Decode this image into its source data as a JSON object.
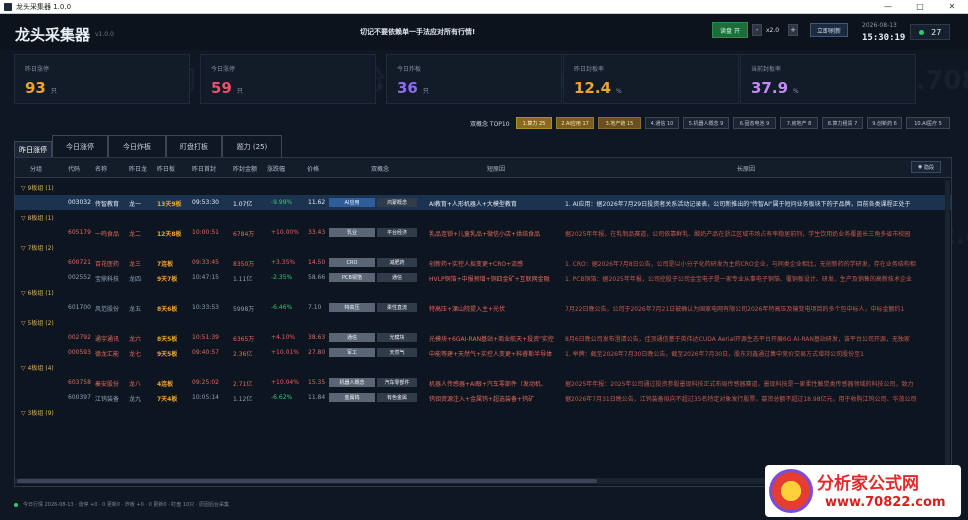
{
  "window": {
    "title": "龙头采集器 1.0.0",
    "min": "—",
    "max": "□",
    "close": "✕"
  },
  "header": {
    "app_title": "龙头采集器",
    "version": "v1.0.0",
    "slogan": "切记不要依赖单一手法应对所有行情!",
    "auto_btn": "读盘 开",
    "minus": "-",
    "speed": "x2.0",
    "plus": "+",
    "refresh_btn": "立即刷新",
    "date": "2026-08-13",
    "time": "15:30:19",
    "count": "27",
    "status_color": "#2ecc71"
  },
  "stats": [
    {
      "label": "昨日涨停",
      "value": "93",
      "unit": "只",
      "color": "#f0a32a"
    },
    {
      "label": "今日涨停",
      "value": "59",
      "unit": "只",
      "color": "#ef4f6a"
    },
    {
      "label": "今日炸板",
      "value": "36",
      "unit": "只",
      "color": "#8d6cf0"
    },
    {
      "label": "昨日封板率",
      "value": "12.4",
      "unit": "%",
      "color": "#f0a32a"
    },
    {
      "label": "当前封板率",
      "value": "37.9",
      "unit": "%",
      "color": "#c58af5"
    }
  ],
  "concepts": {
    "label": "双概念 TOP10",
    "items": [
      "1.算力 25",
      "2.AI应用 17",
      "3.地产链 15",
      "4.通信 10",
      "5.机器人概念 9",
      "6.固态电池 9",
      "7.房地产 8",
      "8.算力租赁 7",
      "9.创新药 6",
      "10.AI医疗 5"
    ]
  },
  "tabs": [
    "昨日涨停",
    "今日涨停",
    "今日炸板",
    "盯盘打板",
    "题力 (25)"
  ],
  "table": {
    "headers": [
      "分组",
      "代码",
      "名称",
      "昨日龙",
      "昨日板",
      "昨日首封",
      "昨封金额",
      "涨跌幅",
      "价格",
      "双概念",
      "短原因",
      "长原因"
    ],
    "hide_btn": "隐段",
    "groups": [
      {
        "label": "▽ 9板组 (1)",
        "rows": [
          {
            "code": "003032",
            "name": "传智教育",
            "dragon": "龙一",
            "board": "13天9板",
            "first": "09:53:30",
            "amount": "1.07亿",
            "chg": "-9.99%",
            "price": "11.62",
            "tag1": "AI应用",
            "tag2": "鸿蒙概念",
            "short": "AI教育+人形机器人+大模型教育",
            "long": "1. AI应用：据2026年7月29日投资者关系活动记录表，公司新推出的\"传智AI\"属于短问业务板块下的子品牌，目前各类课程正处于",
            "sel": true
          }
        ]
      },
      {
        "label": "▽ 8板组 (1)",
        "rows": [
          {
            "code": "605179",
            "name": "一鸣食品",
            "dragon": "龙二",
            "board": "12天8板",
            "first": "10:00:51",
            "amount": "6784万",
            "chg": "+10.00%",
            "price": "33.43",
            "tag1": "乳业",
            "tag2": "平台经济",
            "short": "乳品连锁+儿童乳品+微信小店+烘焙食品",
            "long": "据2025年年报，在乳制品赛道，公司依靠鲜乳、酸奶产品在浙江区域市场占有率稳居前列，学生饮用奶业务覆盖长三角多省市校园"
          }
        ]
      },
      {
        "label": "▽ 7板组 (2)",
        "rows": [
          {
            "code": "600721",
            "name": "百花医药",
            "dragon": "龙三",
            "board": "7连板",
            "first": "09:33:45",
            "amount": "8350万",
            "chg": "+3.35%",
            "price": "14.50",
            "tag1": "CRO",
            "tag2": "减肥药",
            "short": "创新药+实控人拟变更+CRO+流感",
            "long": "1. CRO：据2026年7月8日公告，公司是以小分子化药研发为主的CRO企业，与同类企业相比，无创新药的学研发，存在业务结构相"
          },
          {
            "code": "002552",
            "name": "宝鼎科技",
            "dragon": "龙四",
            "board": "9天7板",
            "first": "10:47:15",
            "amount": "1.11亿",
            "chg": "-2.35%",
            "price": "58.66",
            "tag1": "PCB铜箔",
            "tag2": "通信",
            "short": "HVLP铜箔+中报预增+铜四金矿+互联网金融",
            "long": "1. PCB铜箔：据2025年年报，公司控股子公司金宝电子是一家专业从事电子铜箔、覆铜板设计、研发、生产及销售的高新技术企业"
          }
        ]
      },
      {
        "label": "▽ 6板组 (1)",
        "rows": [
          {
            "code": "601700",
            "name": "风范股份",
            "dragon": "龙五",
            "board": "8天6板",
            "first": "10:33:53",
            "amount": "5998万",
            "chg": "-6.46%",
            "price": "7.10",
            "tag1": "特高压",
            "tag2": "柔性直流",
            "short": "特高压+溧山院提入主+光伏",
            "long": "7月22日晚公告，公司于2026年7月21日被确认为国家电网有限公司2026年特高压及输变电项目的多个包中标人，中标金额约1"
          }
        ]
      },
      {
        "label": "▽ 5板组 (2)",
        "rows": [
          {
            "code": "002792",
            "name": "通宇通讯",
            "dragon": "龙六",
            "board": "8天5板",
            "first": "10:51:39",
            "amount": "6365万",
            "chg": "+4.10%",
            "price": "38.63",
            "tag1": "通信",
            "tag2": "光模块",
            "short": "光模块+6GAI-RAN基站+商业航天+投资\"实控",
            "long": "8月6日晚公司发布澄清公告，佳顶通信基于英伟达CUDA Aerial开源生态平台开展6G AI-RAN基站研发，该平台公司开源，无独家"
          },
          {
            "code": "000593",
            "name": "德龙汇能",
            "dragon": "龙七",
            "board": "9天5板",
            "first": "09:40:57",
            "amount": "2.36亿",
            "chg": "+10.01%",
            "price": "27.80",
            "tag1": "军工",
            "tag2": "天然气",
            "short": "中能等建+天然气+实控人变更+科睿斯半导体",
            "long": "1. 举牌：截至2026年7月30日晚公告，截至2026年7月30日，股东刘鑫通过集中竞价交易方式增持公司股份至1"
          }
        ]
      },
      {
        "label": "▽ 4板组 (4)",
        "rows": [
          {
            "code": "603758",
            "name": "秦安股份",
            "dragon": "龙八",
            "board": "4连板",
            "first": "09:25:02",
            "amount": "2.71亿",
            "chg": "+10.04%",
            "price": "15.35",
            "tag1": "机器人概念",
            "tag2": "汽车零部件",
            "short": "机器人传感器+AI眼+汽车零部件（发动机、",
            "long": "据2025年年报：2025年公司通过投资参股墨现科技正式布局传感器赛道，墨现科技是一家柔性触觉类传感器领域的科技公司，致力"
          },
          {
            "code": "600397",
            "name": "江钨装备",
            "dragon": "龙九",
            "board": "7天4板",
            "first": "10:05:14",
            "amount": "1.12亿",
            "chg": "-6.62%",
            "price": "11.84",
            "tag1": "金属钨",
            "tag2": "有色金属",
            "short": "钨钼资源注入+金属钨+超选装备+钨矿",
            "long": "据2026年7月31日晚公告，江钨装备拟向不超过35名特定对象发行股票，募资总额不超过18.98亿元，用于收购江钨公司、华茂公司"
          }
        ]
      },
      {
        "label": "▽ 3板组 (9)",
        "rows": []
      }
    ]
  },
  "footer": "今日行情 2026-08-13 · 涨停 +0 · 0 更新0 · 炸板 +0 · 0 更新0 · 盯盘 10只 · 原因后台采集",
  "logo": {
    "title": "分析家公式网",
    "url": "www.70822.com"
  },
  "watermark": "分析家公式网 www.70822.com"
}
